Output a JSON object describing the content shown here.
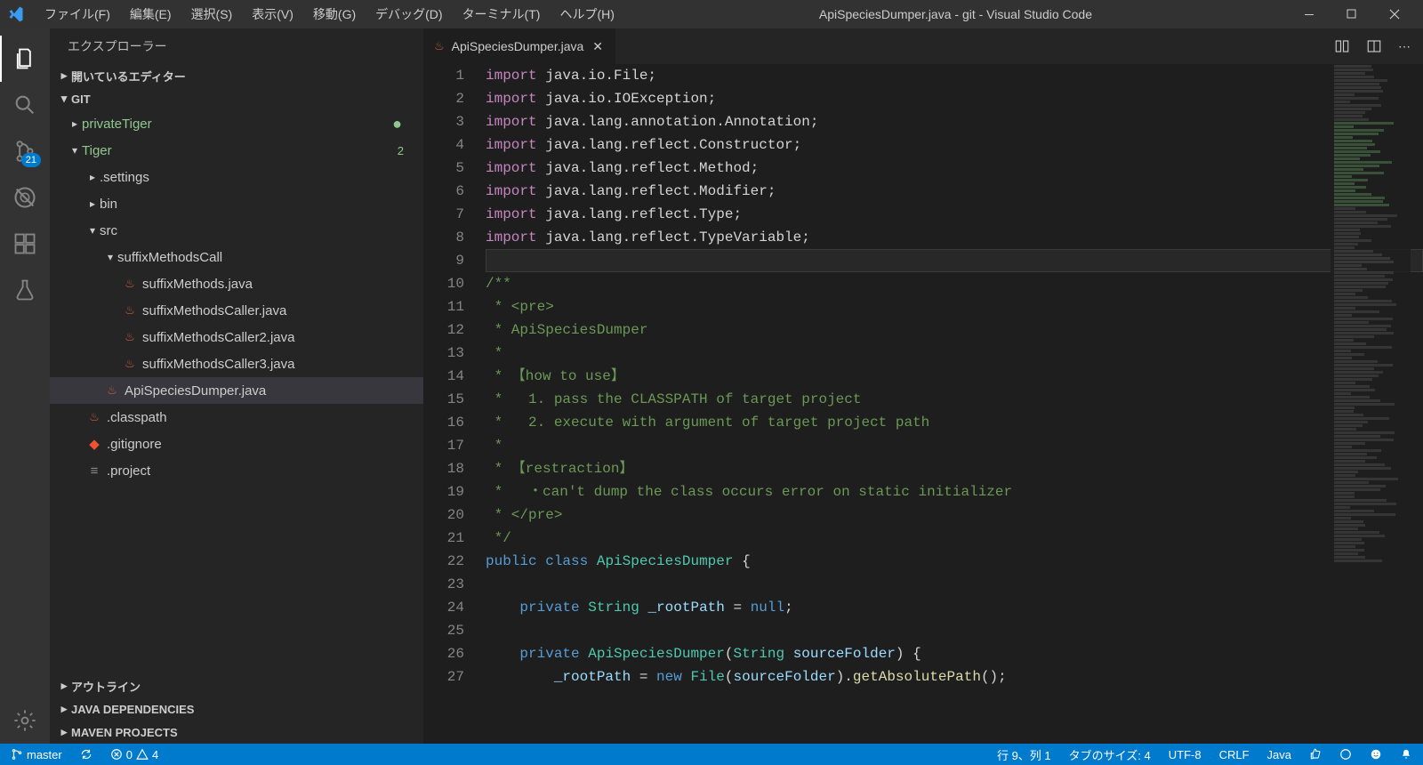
{
  "window": {
    "title": "ApiSpeciesDumper.java - git - Visual Studio Code"
  },
  "menu": {
    "file": "ファイル(F)",
    "edit": "編集(E)",
    "selection": "選択(S)",
    "view": "表示(V)",
    "go": "移動(G)",
    "debug": "デバッグ(D)",
    "terminal": "ターミナル(T)",
    "help": "ヘルプ(H)"
  },
  "activity": {
    "scm_badge": "21"
  },
  "sidebar": {
    "title": "エクスプローラー",
    "open_editors": "開いているエディター",
    "root": "GIT",
    "outline": "アウトライン",
    "java_deps": "JAVA DEPENDENCIES",
    "maven": "MAVEN PROJECTS",
    "tree": {
      "privateTiger": "privateTiger",
      "tiger": "Tiger",
      "tiger_badge": "2",
      "settings": ".settings",
      "bin": "bin",
      "src": "src",
      "suffixMethodsCall": "suffixMethodsCall",
      "f1": "suffixMethods.java",
      "f2": "suffixMethodsCaller.java",
      "f3": "suffixMethodsCaller2.java",
      "f4": "suffixMethodsCaller3.java",
      "f5": "ApiSpeciesDumper.java",
      "classpath": ".classpath",
      "gitignore": ".gitignore",
      "project": ".project"
    }
  },
  "tab": {
    "name": "ApiSpeciesDumper.java"
  },
  "code": {
    "lines": [
      {
        "n": 1,
        "t": "import",
        "r": " java.io.File;"
      },
      {
        "n": 2,
        "t": "import",
        "r": " java.io.IOException;"
      },
      {
        "n": 3,
        "t": "import",
        "r": " java.lang.annotation.Annotation;"
      },
      {
        "n": 4,
        "t": "import",
        "r": " java.lang.reflect.Constructor;"
      },
      {
        "n": 5,
        "t": "import",
        "r": " java.lang.reflect.Method;"
      },
      {
        "n": 6,
        "t": "import",
        "r": " java.lang.reflect.Modifier;"
      },
      {
        "n": 7,
        "t": "import",
        "r": " java.lang.reflect.Type;"
      },
      {
        "n": 8,
        "t": "import",
        "r": " java.lang.reflect.TypeVariable;"
      },
      {
        "n": 9,
        "t": "",
        "r": ""
      },
      {
        "n": 10,
        "c": "/**"
      },
      {
        "n": 11,
        "c": " * <pre>"
      },
      {
        "n": 12,
        "c": " * ApiSpeciesDumper"
      },
      {
        "n": 13,
        "c": " *"
      },
      {
        "n": 14,
        "c": " * 【how to use】"
      },
      {
        "n": 15,
        "c": " *   1. pass the CLASSPATH of target project"
      },
      {
        "n": 16,
        "c": " *   2. execute with argument of target project path"
      },
      {
        "n": 17,
        "c": " *"
      },
      {
        "n": 18,
        "c": " * 【restraction】"
      },
      {
        "n": 19,
        "c": " *   ・can't dump the class occurs error on static initializer"
      },
      {
        "n": 20,
        "c": " * </pre>"
      },
      {
        "n": 21,
        "c": " */"
      }
    ],
    "line22": {
      "public": "public",
      "class": "class",
      "name": "ApiSpeciesDumper",
      "brace": " {"
    },
    "line24": {
      "private": "private",
      "type": "String",
      "name": "_rootPath",
      "rest": " = ",
      "null": "null",
      "semi": ";"
    },
    "line26": {
      "private": "private",
      "type": "ApiSpeciesDumper",
      "lp": "(",
      "argtype": "String",
      "argname": "sourceFolder",
      "rp": ") {"
    },
    "line27": {
      "indent": "        ",
      "name": "_rootPath",
      "eq": " = ",
      "new": "new",
      "type": "File",
      "lp": "(",
      "arg": "sourceFolder",
      "rp": ").",
      "fn": "getAbsolutePath",
      "end": "();"
    }
  },
  "status": {
    "branch": "master",
    "errors": "0",
    "warnings": "4",
    "cursor": "行 9、列 1",
    "tabsize": "タブのサイズ: 4",
    "encoding": "UTF-8",
    "eol": "CRLF",
    "language": "Java"
  }
}
